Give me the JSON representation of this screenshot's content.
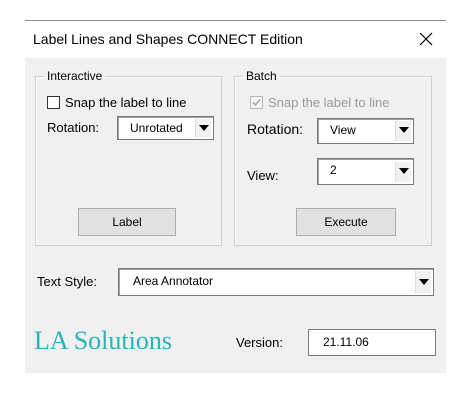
{
  "window": {
    "title": "Label Lines and Shapes CONNECT Edition",
    "close_icon": "close-icon"
  },
  "interactive": {
    "legend": "Interactive",
    "snap_label": "Snap the label to line",
    "snap_checked": false,
    "rotation_label": "Rotation:",
    "rotation_value": "Unrotated",
    "button_label": "Label"
  },
  "batch": {
    "legend": "Batch",
    "snap_label": "Snap the label to line",
    "snap_checked": true,
    "snap_disabled": true,
    "rotation_label": "Rotation:",
    "rotation_value": "View",
    "view_label": "View:",
    "view_value": "2",
    "button_label": "Execute"
  },
  "text_style": {
    "label": "Text Style:",
    "value": "Area Annotator"
  },
  "footer": {
    "brand": "LA Solutions",
    "version_label": "Version:",
    "version_value": "21.11.06"
  },
  "colors": {
    "brand": "#2ab3b8",
    "dialog_bg": "#f0f0f0",
    "button_bg": "#e1e1e1"
  }
}
